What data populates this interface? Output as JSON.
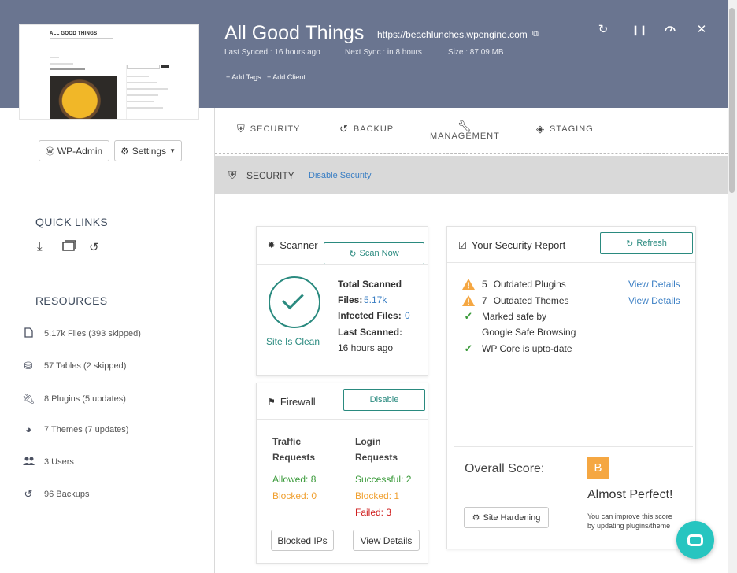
{
  "site": {
    "title": "All Good Things",
    "url": "https://beachlunches.wpengine.com",
    "last_synced": "Last Synced : 16 hours ago",
    "next_sync": "Next Sync : in 8 hours",
    "size": "Size : 87.09 MB",
    "add_tags": "Add Tags",
    "add_client": "Add Client"
  },
  "thumbnail": {
    "title": "ALL GOOD THINGS"
  },
  "sidebar": {
    "wp_admin": "WP-Admin",
    "settings": "Settings",
    "quick_links_heading": "QUICK LINKS",
    "resources_heading": "RESOURCES",
    "resources": [
      {
        "icon": "file-icon",
        "label": "5.17k Files (393 skipped)"
      },
      {
        "icon": "database-icon",
        "label": "57 Tables (2 skipped)"
      },
      {
        "icon": "plugin-icon",
        "label": "8 Plugins (5 updates)"
      },
      {
        "icon": "palette-icon",
        "label": "7 Themes (7 updates)"
      },
      {
        "icon": "users-icon",
        "label": "3 Users"
      },
      {
        "icon": "history-icon",
        "label": "96 Backups"
      }
    ]
  },
  "tabs": {
    "security": "SECURITY",
    "backup": "BACKUP",
    "management": "MANAGEMENT",
    "staging": "STAGING"
  },
  "subbar": {
    "title": "SECURITY",
    "disable_link": "Disable Security"
  },
  "scanner": {
    "title": "Scanner",
    "scan_now": "Scan Now",
    "status": "Site Is Clean",
    "total_scanned_label": "Total Scanned",
    "files_label": "Files:",
    "files_value": "5.17k",
    "infected_label": "Infected Files:",
    "infected_value": "0",
    "last_scanned_label": "Last Scanned:",
    "last_scanned_value": "16 hours ago"
  },
  "firewall": {
    "title": "Firewall",
    "disable": "Disable",
    "traffic_heading_1": "Traffic",
    "traffic_heading_2": "Requests",
    "login_heading_1": "Login",
    "login_heading_2": "Requests",
    "allowed": "Allowed: 8",
    "traffic_blocked": "Blocked: 0",
    "successful": "Successful: 2",
    "login_blocked": "Blocked: 1",
    "failed": "Failed: 3",
    "blocked_ips": "Blocked IPs",
    "view_details": "View Details"
  },
  "report": {
    "title": "Your Security Report",
    "refresh": "Refresh",
    "plugins_count": "5",
    "plugins_label": "Outdated Plugins",
    "themes_count": "7",
    "themes_label": "Outdated Themes",
    "view_details": "View Details",
    "safe_browsing_1": "Marked safe by",
    "safe_browsing_2": "Google Safe Browsing",
    "wp_core": "WP Core is upto-date",
    "overall_label": "Overall Score:",
    "grade": "B",
    "verdict": "Almost Perfect!",
    "site_hardening": "Site Hardening",
    "improve_1": "You can improve this score",
    "improve_2": "by updating plugins/theme"
  },
  "colors": {
    "header": "#6a7590",
    "accent": "#2a8a7f",
    "link": "#3b7fc4",
    "warning": "#f5a742",
    "chat": "#27c5c0"
  }
}
